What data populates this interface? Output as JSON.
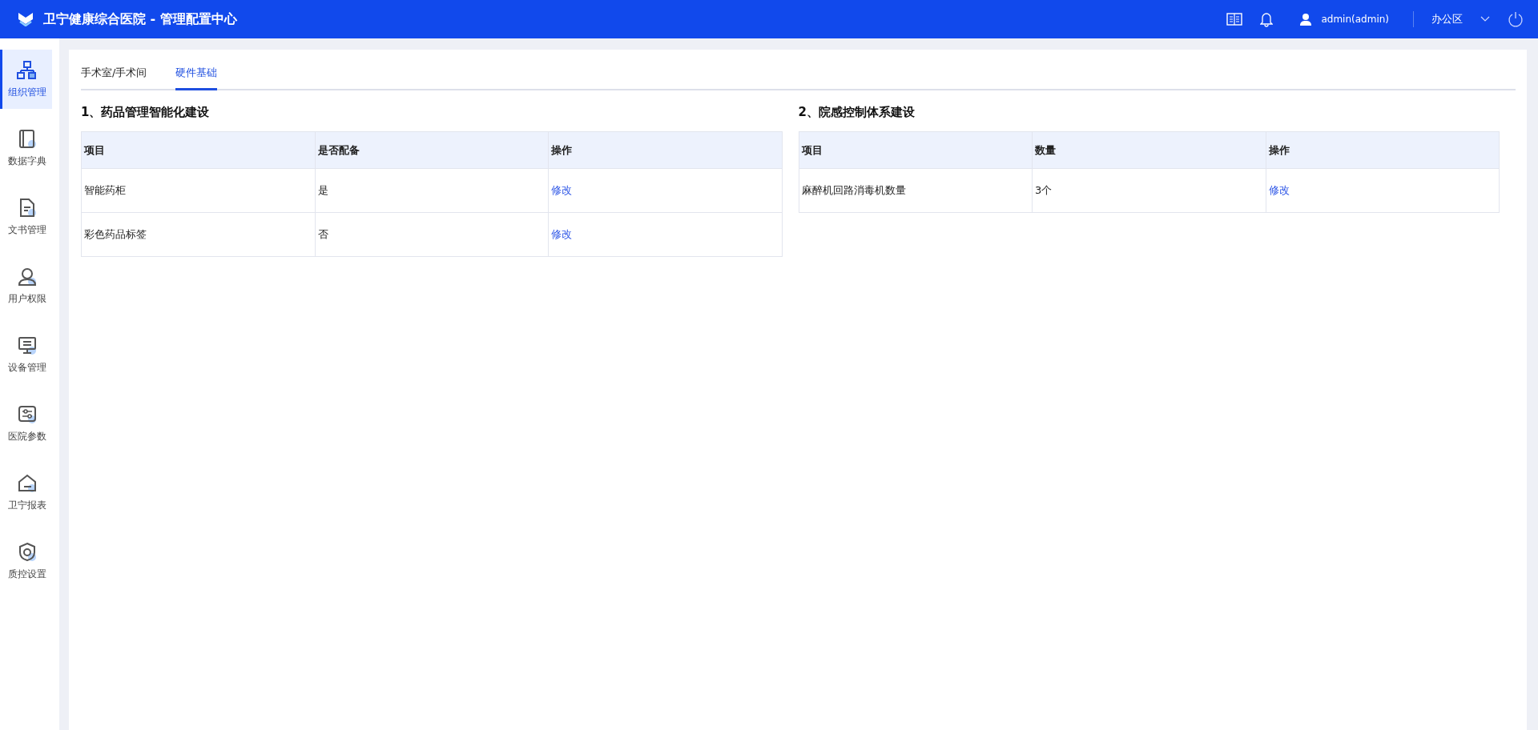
{
  "header": {
    "title": "卫宁健康综合医院 - 管理配置中心",
    "user": "admin(admin)",
    "area": "办公区"
  },
  "sidebar": {
    "items": [
      {
        "label": "组织管理",
        "selected": true
      },
      {
        "label": "数据字典",
        "selected": false
      },
      {
        "label": "文书管理",
        "selected": false
      },
      {
        "label": "用户权限",
        "selected": false
      },
      {
        "label": "设备管理",
        "selected": false
      },
      {
        "label": "医院参数",
        "selected": false
      },
      {
        "label": "卫宁报表",
        "selected": false
      },
      {
        "label": "质控设置",
        "selected": false
      }
    ]
  },
  "tabs": [
    {
      "label": "手术室/手术间",
      "selected": false
    },
    {
      "label": "硬件基础",
      "selected": true
    }
  ],
  "sections": [
    {
      "title": "1、药品管理智能化建设",
      "columns": [
        "项目",
        "是否配备",
        "操作"
      ],
      "rows": [
        {
          "cells": [
            "智能药柜",
            "是"
          ],
          "action": "修改"
        },
        {
          "cells": [
            "彩色药品标签",
            "否"
          ],
          "action": "修改"
        }
      ]
    },
    {
      "title": "2、院感控制体系建设",
      "columns": [
        "项目",
        "数量",
        "操作"
      ],
      "rows": [
        {
          "cells": [
            "麻醉机回路消毒机数量",
            "3个"
          ],
          "action": "修改"
        }
      ]
    }
  ]
}
